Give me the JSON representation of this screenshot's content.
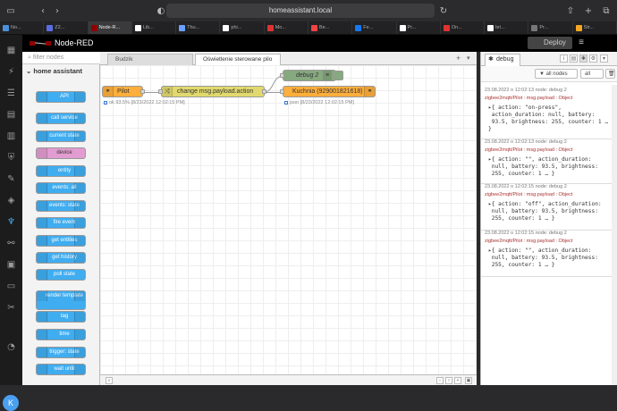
{
  "browser": {
    "address": "homeassistant.local",
    "tabs": [
      {
        "label": "No...",
        "color": "#4a90d9"
      },
      {
        "label": "Z2...",
        "color": "#5b6ee1"
      },
      {
        "label": "Node-R...",
        "color": "#8f0000"
      },
      {
        "label": "Lib...",
        "color": "#ffffff"
      },
      {
        "label": "Thu...",
        "color": "#6aa0ff"
      },
      {
        "label": "phi...",
        "color": "#ffffff"
      },
      {
        "label": "Mo...",
        "color": "#d33"
      },
      {
        "label": "Be...",
        "color": "#e44"
      },
      {
        "label": "Fe...",
        "color": "#1877f2"
      },
      {
        "label": "Pr...",
        "color": "#ffffff"
      },
      {
        "label": "On...",
        "color": "#d33"
      },
      {
        "label": "bri...",
        "color": "#ffffff"
      },
      {
        "label": "Pr...",
        "color": "#777777"
      },
      {
        "label": "Str...",
        "color": "#f5a623"
      }
    ]
  },
  "nodered": {
    "title": "Node-RED",
    "deploy_label": "Deploy",
    "filter_placeholder": "filter nodes",
    "category": "home assistant",
    "palette": [
      "API",
      "call service",
      "current state",
      "device",
      "entity",
      "events: all",
      "events: state",
      "fire event",
      "get entities",
      "get history",
      "poll state",
      "render template",
      "tag",
      "time",
      "trigger: state",
      "wait until"
    ],
    "workspace_tabs": [
      "Budzik",
      "Oświetlenie sterowane pilo"
    ],
    "flow": {
      "pilot_label": "Pilot",
      "pilot_status": "ok  93.5% [8/23/2022 12:02:15 PM]",
      "change_label": "change msg.payload.action",
      "debug_label": "debug 2",
      "kuchnia_label": "Kuchnia (929001821618)",
      "kuchnia_status": "json [8/23/2022 12:02:15 PM]"
    },
    "sidebar": {
      "tab_label": "debug",
      "filter_select": "all nodes",
      "clear_select": "all",
      "messages": [
        {
          "meta": "23.08.2022 o 12:02:13   node: debug 2",
          "topic": "zigbee2mqtt/Pilot : msg.payload : Object",
          "l1": "▸{ action: \"on-press\",",
          "l2": " action_duration: null, battery:",
          "l3": " 93.5, brightness: 255, counter: 1 …",
          "l4": "}"
        },
        {
          "meta": "23.08.2022 o 12:02:13   node: debug 2",
          "topic": "zigbee2mqtt/Pilot : msg.payload : Object",
          "l1": "▸{ action: \"\", action_duration:",
          "l2": " null, battery: 93.5, brightness:",
          "l3": " 255, counter: 1 … }",
          "l4": ""
        },
        {
          "meta": "23.08.2022 o 12:02:15   node: debug 2",
          "topic": "zigbee2mqtt/Pilot : msg.payload : Object",
          "l1": "▸{ action: \"off\", action_duration:",
          "l2": " null, battery: 93.5, brightness:",
          "l3": " 255, counter: 1 … }",
          "l4": ""
        },
        {
          "meta": "23.08.2022 o 12:02:15   node: debug 2",
          "topic": "zigbee2mqtt/Pilot : msg.payload : Object",
          "l1": "▸{ action: \"\", action_duration:",
          "l2": " null, battery: 93.5, brightness:",
          "l3": " 255, counter: 1 … }",
          "l4": ""
        }
      ]
    }
  },
  "ha": {
    "avatar_letter": "K"
  },
  "colors": {
    "accent": "#3fadf0",
    "function_orange": "#fdae3b",
    "change_yellow": "#e2d96e",
    "debug_green": "#87a980"
  }
}
